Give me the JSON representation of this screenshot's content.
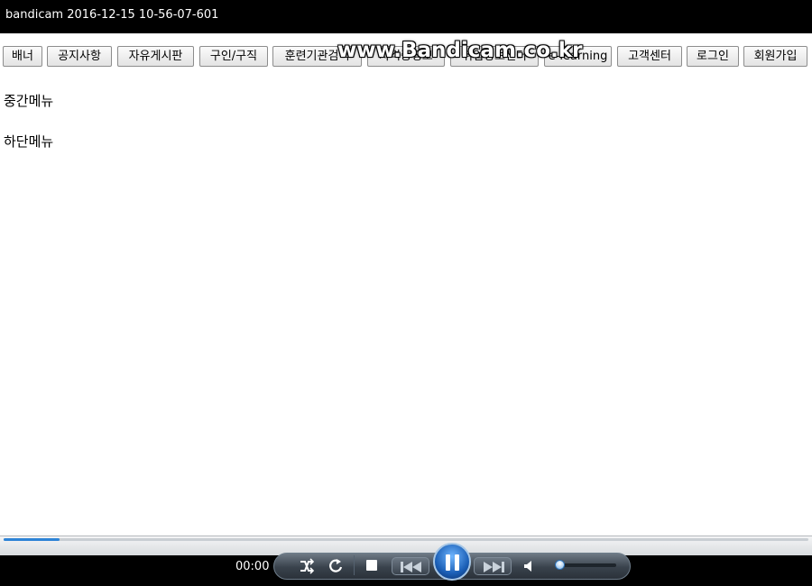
{
  "titlebar": {
    "title": "bandicam 2016-12-15 10-56-07-601"
  },
  "watermark": "www.Bandicam.co.kr",
  "menu": {
    "buttons": [
      "배너",
      "공지사항",
      "자유게시판",
      "구인/구직",
      "훈련기관검색",
      "자격증정보",
      "취업정보센터",
      "e-learning",
      "고객센터",
      "로그인",
      "회원가입"
    ]
  },
  "sections": {
    "middle_menu": "중간메뉴",
    "bottom_menu": "하단메뉴"
  },
  "player": {
    "time": "00:00",
    "progress_fraction": 0.07,
    "volume_fraction": 0.05,
    "icons": [
      "shuffle-icon",
      "repeat-icon",
      "stop-icon",
      "previous-icon",
      "pause-icon",
      "next-icon",
      "volume-icon"
    ]
  }
}
